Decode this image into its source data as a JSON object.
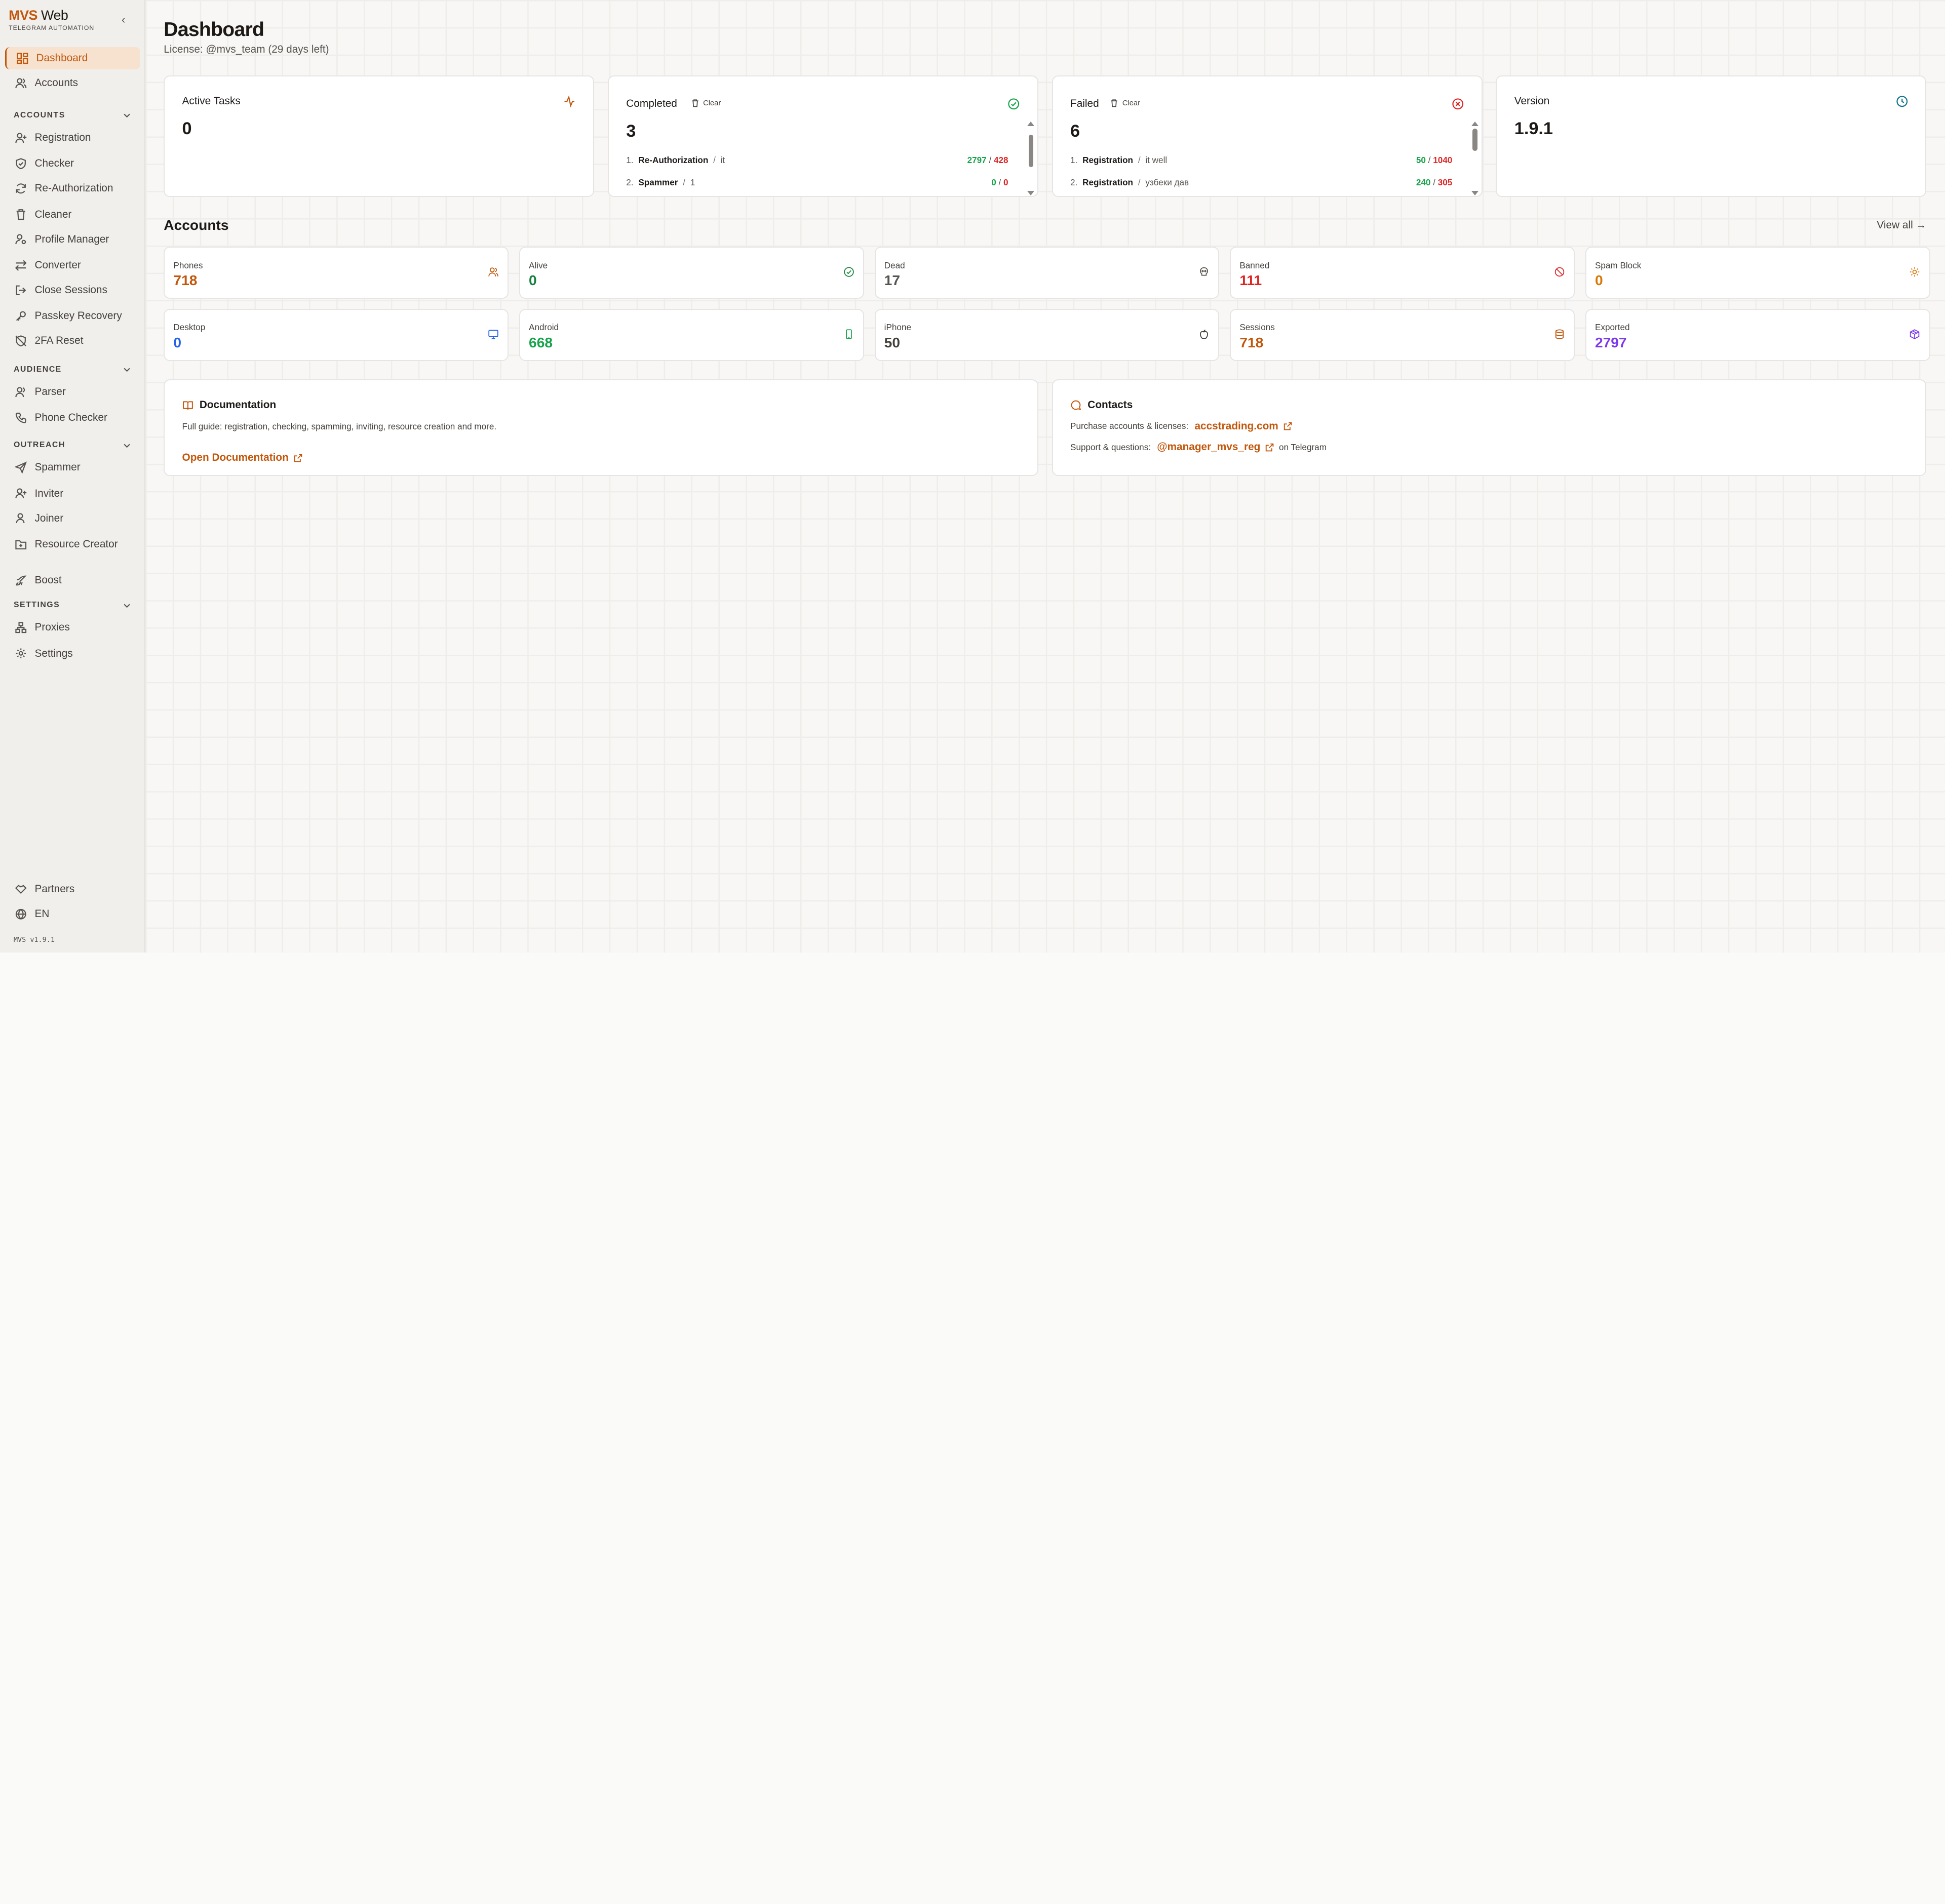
{
  "brand": {
    "name_a": "MVS",
    "name_b": "Web",
    "tagline": "TELEGRAM AUTOMATION"
  },
  "sidebar": {
    "top": [
      {
        "label": "Dashboard",
        "icon": "dashboard-icon"
      },
      {
        "label": "Accounts",
        "icon": "users-icon"
      }
    ],
    "sections": [
      {
        "title": "ACCOUNTS",
        "items": [
          "Registration",
          "Checker",
          "Re-Authorization",
          "Cleaner",
          "Profile Manager",
          "Converter",
          "Close Sessions",
          "Passkey Recovery",
          "2FA Reset"
        ]
      },
      {
        "title": "AUDIENCE",
        "items": [
          "Parser",
          "Phone Checker"
        ]
      },
      {
        "title": "OUTREACH",
        "items": [
          "Spammer",
          "Inviter",
          "Joiner",
          "Resource Creator"
        ]
      },
      {
        "title": "SETTINGS",
        "items": [
          "Proxies",
          "Settings"
        ]
      }
    ],
    "boost": "Boost",
    "footer": [
      "Partners",
      "EN"
    ],
    "version": "MVS v1.9.1"
  },
  "page": {
    "title": "Dashboard",
    "license": "License: @mvs_team (29 days left)"
  },
  "stats": {
    "active": {
      "title": "Active Tasks",
      "value": "0"
    },
    "completed": {
      "title": "Completed",
      "clear": "Clear",
      "value": "3",
      "rows": [
        {
          "n": "1.",
          "name": "Re-Authorization",
          "sub": "it",
          "ok": "2797",
          "fail": "428"
        },
        {
          "n": "2.",
          "name": "Spammer",
          "sub": "1",
          "ok": "0",
          "fail": "0"
        }
      ]
    },
    "failed": {
      "title": "Failed",
      "clear": "Clear",
      "value": "6",
      "rows": [
        {
          "n": "1.",
          "name": "Registration",
          "sub": "it well",
          "ok": "50",
          "fail": "1040"
        },
        {
          "n": "2.",
          "name": "Registration",
          "sub": "узбеки дав",
          "ok": "240",
          "fail": "305"
        }
      ]
    },
    "version": {
      "title": "Version",
      "value": "1.9.1"
    }
  },
  "accounts": {
    "title": "Accounts",
    "view_all": "View all →",
    "metrics": [
      {
        "label": "Phones",
        "value": "718",
        "color": "#c2570c",
        "icon": "users-icon"
      },
      {
        "label": "Alive",
        "value": "0",
        "color": "#15803d",
        "icon": "check-circle-icon"
      },
      {
        "label": "Dead",
        "value": "17",
        "color": "#57534e",
        "icon": "skull-icon"
      },
      {
        "label": "Banned",
        "value": "111",
        "color": "#dc2626",
        "icon": "ban-icon"
      },
      {
        "label": "Spam Block",
        "value": "0",
        "color": "#d97706",
        "icon": "sun-icon"
      },
      {
        "label": "Desktop",
        "value": "0",
        "color": "#2563eb",
        "icon": "monitor-icon"
      },
      {
        "label": "Android",
        "value": "668",
        "color": "#16a34a",
        "icon": "phone-icon"
      },
      {
        "label": "iPhone",
        "value": "50",
        "color": "#44403c",
        "icon": "apple-icon"
      },
      {
        "label": "Sessions",
        "value": "718",
        "color": "#c2570c",
        "icon": "database-icon"
      },
      {
        "label": "Exported",
        "value": "2797",
        "color": "#7c3aed",
        "icon": "package-icon"
      }
    ]
  },
  "docs": {
    "title": "Documentation",
    "text": "Full guide: registration, checking, spamming, inviting, resource creation and more.",
    "link": "Open Documentation"
  },
  "contacts": {
    "title": "Contacts",
    "purchase_label": "Purchase accounts & licenses:",
    "purchase_link": "accstrading.com",
    "support_label": "Support & questions:",
    "support_link": "@manager_mvs_reg",
    "support_suffix": "on Telegram"
  }
}
